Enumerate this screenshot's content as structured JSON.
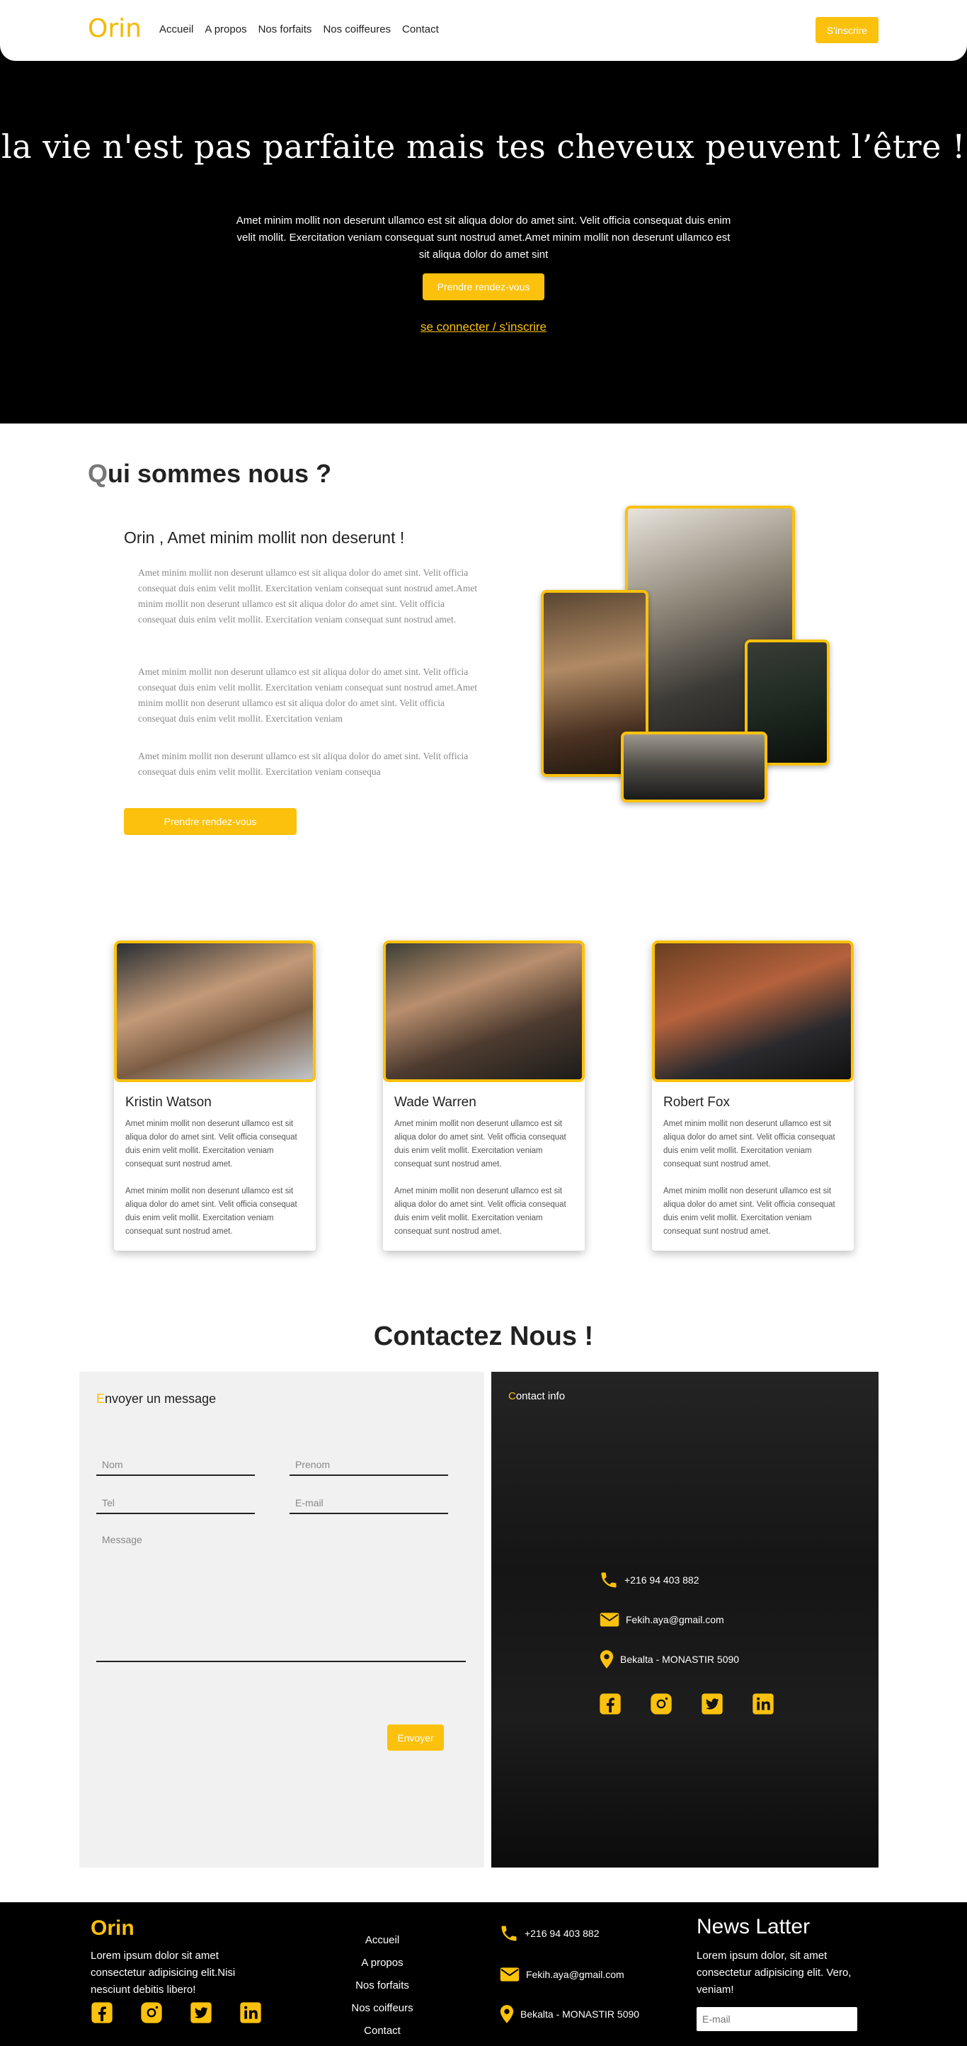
{
  "nav": {
    "logo": "Orin",
    "links": [
      "Accueil",
      "A propos",
      "Nos forfaits",
      "Nos coiffeures",
      "Contact"
    ],
    "signup": "S'inscrire"
  },
  "hero": {
    "title": "la vie n'est pas parfaite mais tes cheveux peuvent l’être !",
    "text": "Amet minim mollit non deserunt ullamco est sit aliqua dolor do amet sint. Velit officia consequat duis enim velit mollit. Exercitation veniam consequat sunt nostrud amet.Amet minim mollit non deserunt ullamco est sit aliqua dolor do amet sint",
    "cta": "Prendre rendez-vous",
    "login_link": "se connecter / s'inscrire"
  },
  "about": {
    "title_first": "Q",
    "title_rest": "ui sommes nous ?",
    "subtitle": "Orin , Amet minim mollit non deserunt !",
    "paragraphs": [
      "Amet minim mollit non deserunt ullamco est sit aliqua dolor do amet sint. Velit officia consequat duis enim velit mollit. Exercitation veniam consequat sunt nostrud amet.Amet minim mollit non deserunt ullamco est sit aliqua dolor do amet sint. Velit officia consequat duis enim velit mollit. Exercitation veniam consequat sunt nostrud amet.",
      "Amet minim mollit non deserunt ullamco est sit aliqua dolor do amet sint. Velit officia consequat duis enim velit mollit. Exercitation veniam consequat sunt nostrud amet.Amet minim mollit non deserunt ullamco est sit aliqua dolor do amet sint. Velit officia consequat duis enim velit mollit. Exercitation veniam",
      "Amet minim mollit non deserunt ullamco est sit aliqua dolor do amet sint. Velit officia consequat duis enim velit mollit. Exercitation veniam consequa"
    ],
    "cta": "Prendre rendez-vous"
  },
  "team": [
    {
      "name": "Kristin Watson",
      "p1": "Amet minim mollit non deserunt ullamco est sit aliqua dolor do amet sint. Velit officia consequat duis enim velit mollit. Exercitation veniam consequat sunt nostrud amet.",
      "p2": "Amet minim mollit non deserunt ullamco est sit aliqua dolor do amet sint. Velit officia consequat duis enim velit mollit. Exercitation veniam consequat sunt nostrud amet."
    },
    {
      "name": "Wade Warren",
      "p1": "Amet minim mollit non deserunt ullamco est sit aliqua dolor do amet sint. Velit officia consequat duis enim velit mollit. Exercitation veniam consequat sunt nostrud amet.",
      "p2": "Amet minim mollit non deserunt ullamco est sit aliqua dolor do amet sint. Velit officia consequat duis enim velit mollit. Exercitation veniam consequat sunt nostrud amet."
    },
    {
      "name": "Robert Fox",
      "p1": "Amet minim mollit non deserunt ullamco est sit aliqua dolor do amet sint. Velit officia consequat duis enim velit mollit. Exercitation veniam consequat sunt nostrud amet.",
      "p2": "Amet minim mollit non deserunt ullamco est sit aliqua dolor do amet sint. Velit officia consequat duis enim velit mollit. Exercitation veniam consequat sunt nostrud amet."
    }
  ],
  "contact": {
    "title": "Contactez Nous !",
    "form": {
      "heading_first": "E",
      "heading_rest": "nvoyer un message",
      "nom_placeholder": "Nom",
      "prenom_placeholder": "Prenom",
      "tel_placeholder": "Tel",
      "email_placeholder": "E-mail",
      "message_placeholder": "Message",
      "send": "Envoyer"
    },
    "info": {
      "heading_first": "C",
      "heading_rest": "ontact info",
      "phone": "+216 94 403 882",
      "email": "Fekih.aya@gmail.com",
      "address": "Bekalta - MONASTIR 5090"
    }
  },
  "footer": {
    "logo": "Orin",
    "description": "Lorem ipsum dolor sit amet consectetur adipisicing elit.Nisi nesciunt debitis libero!",
    "links": [
      "Accueil",
      "A propos",
      "Nos forfaits",
      "Nos coiffeurs",
      "Contact"
    ],
    "phone": "+216 94 403 882",
    "email": "Fekih.aya@gmail.com",
    "address": "Bekalta - MONASTIR 5090",
    "newsletter_title": "News Latter",
    "newsletter_text": "Lorem ipsum dolor, sit amet consectetur adipisicing elit. Vero, veniam!",
    "newsletter_placeholder": "E-mail"
  },
  "colors": {
    "accent": "#fbc10d",
    "dark": "#000000",
    "panel": "#f1f1f1"
  },
  "icons": [
    "phone-icon",
    "mail-icon",
    "location-icon",
    "facebook-icon",
    "instagram-icon",
    "twitter-icon",
    "linkedin-icon"
  ]
}
